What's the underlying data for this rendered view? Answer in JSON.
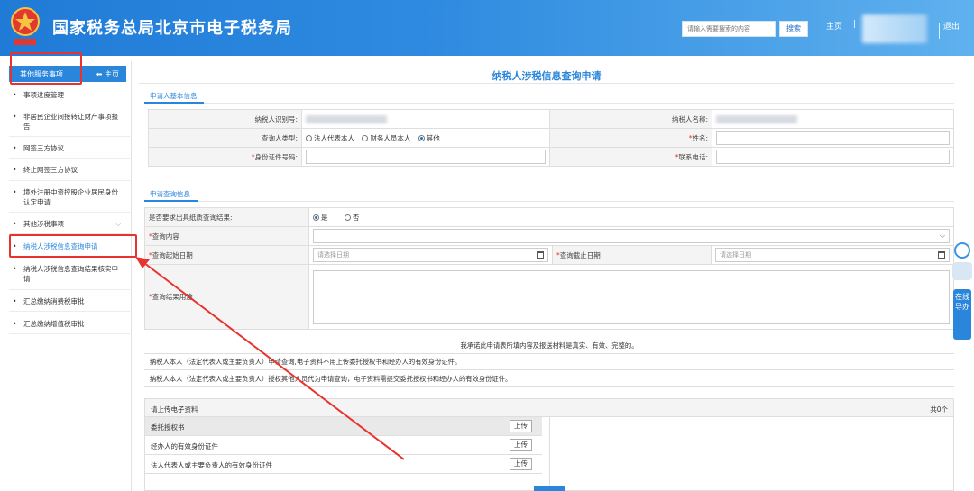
{
  "header": {
    "site_title": "国家税务总局北京市电子税务局",
    "search_placeholder": "请输入需要搜索的内容",
    "search_button": "搜索",
    "home_link": "主页",
    "separator": "|",
    "logout": "| 退出",
    "logout_sep": "|"
  },
  "sidebar": {
    "title": "其他服务事项",
    "home": "主页",
    "items": [
      {
        "label": "事项进度管理"
      },
      {
        "label": "非居民企业间接转让财产事项报告"
      },
      {
        "label": "网签三方协议"
      },
      {
        "label": "终止网签三方协议"
      },
      {
        "label": "境外注册中资控股企业居民身份认定申请"
      },
      {
        "label": "其他涉税事项"
      },
      {
        "label": "纳税人涉税信息查询申请"
      },
      {
        "label": "纳税人涉税信息查询结果核实申请"
      },
      {
        "label": "汇总缴纳消费税审批"
      },
      {
        "label": "汇总缴纳增值税审批"
      }
    ]
  },
  "form": {
    "title": "纳税人涉税信息查询申请",
    "section1_tab": "申请人基本信息",
    "section2_tab": "申请查询信息",
    "taxpayer_id_label": "纳税人识别号:",
    "taxpayer_name_label": "纳税人名称:",
    "applicant_type_label": "查询人类型:",
    "applicant_types": [
      "法人代表本人",
      "财务人员本人",
      "其他"
    ],
    "name_label": "姓名:",
    "id_number_label": "身份证件号码:",
    "phone_label": "联系电话:",
    "paper_result_label": "是否要求出具纸质查询结果:",
    "paper_result_options": [
      "是",
      "否"
    ],
    "query_content_label": "查询内容",
    "start_date_label": "查询起始日期",
    "end_date_label": "查询截止日期",
    "date_placeholder": "请选择日期",
    "purpose_label": "查询结果用途",
    "required_mark": "*",
    "declaration": "我承诺此申请表所填内容及报送材料是真实、有效、完整的。",
    "note1": "纳税人本人（法定代表人或主要负责人）申请查询,电子资料不用上传委托授权书和经办人的有效身份证件。",
    "note2": "纳税人本人（法定代表人或主要负责人）授权其他人员代为申请查询，电子资料需提交委托授权书和经办人的有效身份证件。"
  },
  "upload": {
    "title": "请上传电子资料",
    "count": "共0个",
    "button": "上传",
    "rows": [
      {
        "label": "委托授权书"
      },
      {
        "label": "经办人的有效身份证件"
      },
      {
        "label": "法人代表人或主要负责人的有效身份证件"
      }
    ]
  },
  "float_help": {
    "text": "在线导办"
  },
  "colors": {
    "accent": "#2a86db",
    "header_start": "#1f7bd6",
    "annotation_red": "#e8322f"
  }
}
